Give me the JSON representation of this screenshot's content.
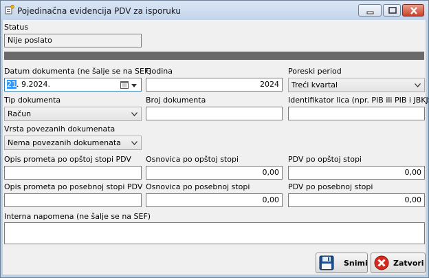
{
  "window": {
    "title": "Pojedinačna evidencija PDV za isporuku"
  },
  "status": {
    "label": "Status",
    "value": "Nije poslato"
  },
  "datum": {
    "label": "Datum dokumenta (ne šalje se na SEF)",
    "day": "21",
    "rest": ". 9.2024."
  },
  "godina": {
    "label": "Godina",
    "value": "2024"
  },
  "poreski_period": {
    "label": "Poreski period",
    "value": "Treći kvartal"
  },
  "tip_dokumenta": {
    "label": "Tip dokumenta",
    "value": "Račun"
  },
  "broj_dokumenta": {
    "label": "Broj dokumenta",
    "value": ""
  },
  "identifikator": {
    "label": "Identifikator lica (npr. PIB ili PIB i JBKJS)",
    "value": ""
  },
  "vrsta_povezanih": {
    "label": "Vrsta povezanih dokumenata",
    "value": "Nema povezanih dokumenata"
  },
  "opsta": {
    "opis_label": "Opis prometa po opštoj stopi PDV",
    "opis_value": "",
    "osnovica_label": "Osnovica po opštoj stopi",
    "osnovica_value": "0,00",
    "pdv_label": "PDV po opštoj stopi",
    "pdv_value": "0,00"
  },
  "posebna": {
    "opis_label": "Opis prometa po posebnoj stopi PDV",
    "opis_value": "",
    "osnovica_label": "Osnovica po posebnoj stopi",
    "osnovica_value": "0,00",
    "pdv_label": "PDV po posebnoj stopi",
    "pdv_value": "0,00"
  },
  "napomena": {
    "label": "Interna napomena (ne šalje se na SEF)",
    "value": ""
  },
  "buttons": {
    "save": "Snimi",
    "close": "Zatvori"
  }
}
